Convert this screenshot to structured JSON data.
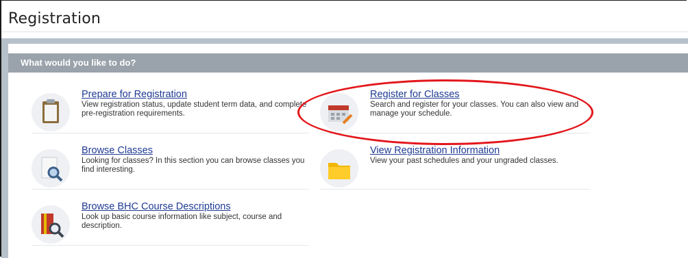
{
  "page": {
    "title": "Registration"
  },
  "card": {
    "header": "What would you like to do?"
  },
  "tiles": [
    {
      "title": "Prepare for Registration",
      "description": "View registration status, update student term data, and complete pre-registration requirements.",
      "icon": "clipboard-icon"
    },
    {
      "title": "Register for Classes",
      "description": "Search and register for your classes. You can also view and manage your schedule.",
      "icon": "calendar-pencil-icon"
    },
    {
      "title": "Browse Classes",
      "description": "Looking for classes? In this section you can browse classes you find interesting.",
      "icon": "document-magnifier-icon"
    },
    {
      "title": "View Registration Information",
      "description": "View your past schedules and your ungraded classes.",
      "icon": "folder-icon"
    },
    {
      "title": "Browse BHC Course Descriptions",
      "description": "Look up basic course information like subject, course and description.",
      "icon": "book-magnifier-icon"
    }
  ],
  "colors": {
    "link": "#1f3a93",
    "card_header": "#9aa3ab",
    "content_background": "#b6c1cb",
    "annotation_circle": "#e3161b"
  }
}
